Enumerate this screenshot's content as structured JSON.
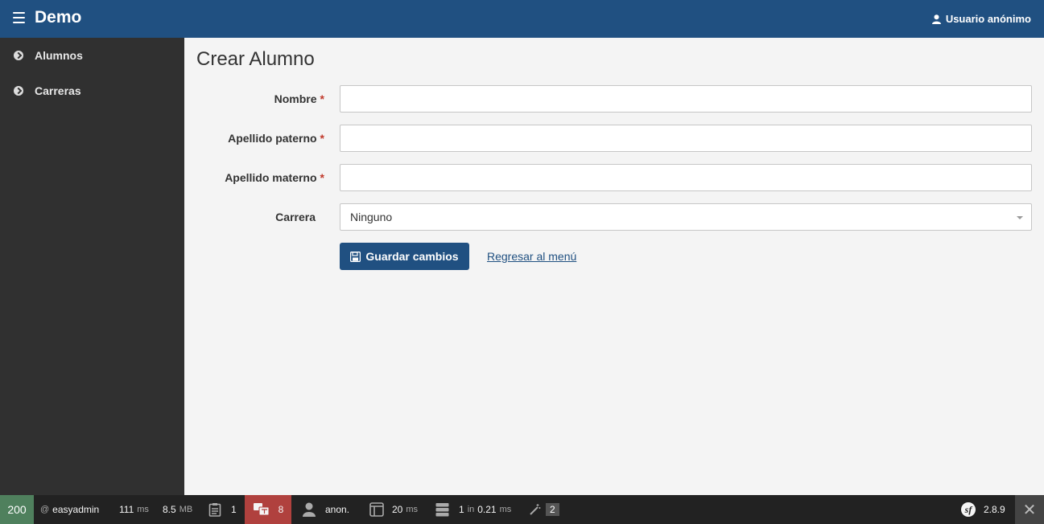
{
  "header": {
    "brand": "Demo",
    "user": "Usuario anónimo"
  },
  "sidebar": {
    "items": [
      {
        "label": "Alumnos"
      },
      {
        "label": "Carreras"
      }
    ]
  },
  "main": {
    "title": "Crear Alumno",
    "fields": [
      {
        "label": "Nombre",
        "required": "*",
        "value": ""
      },
      {
        "label": "Apellido paterno",
        "required": "*",
        "value": ""
      },
      {
        "label": "Apellido materno",
        "required": "*",
        "value": ""
      },
      {
        "label": "Carrera",
        "selected": "Ninguno"
      }
    ],
    "save_label": "Guardar cambios",
    "back_label": "Regresar al menú"
  },
  "toolbar": {
    "status": "200",
    "route_prefix": "@",
    "route": "easyadmin",
    "time_value": "111",
    "time_unit": "ms",
    "memory_value": "8.5",
    "memory_unit": "MB",
    "logs": "1",
    "translations": "8",
    "user": "anon.",
    "twig_value": "20",
    "twig_unit": "ms",
    "db_queries": "1",
    "db_in": "in",
    "db_time": "0.21",
    "db_unit": "ms",
    "forms": "2",
    "version": "2.8.9",
    "sf_logo_letter": "sf",
    "close": "✕"
  },
  "colors": {
    "brand": "#205081",
    "sidebar": "#303030",
    "status_ok": "#4f805d",
    "status_warn": "#b0413e"
  }
}
